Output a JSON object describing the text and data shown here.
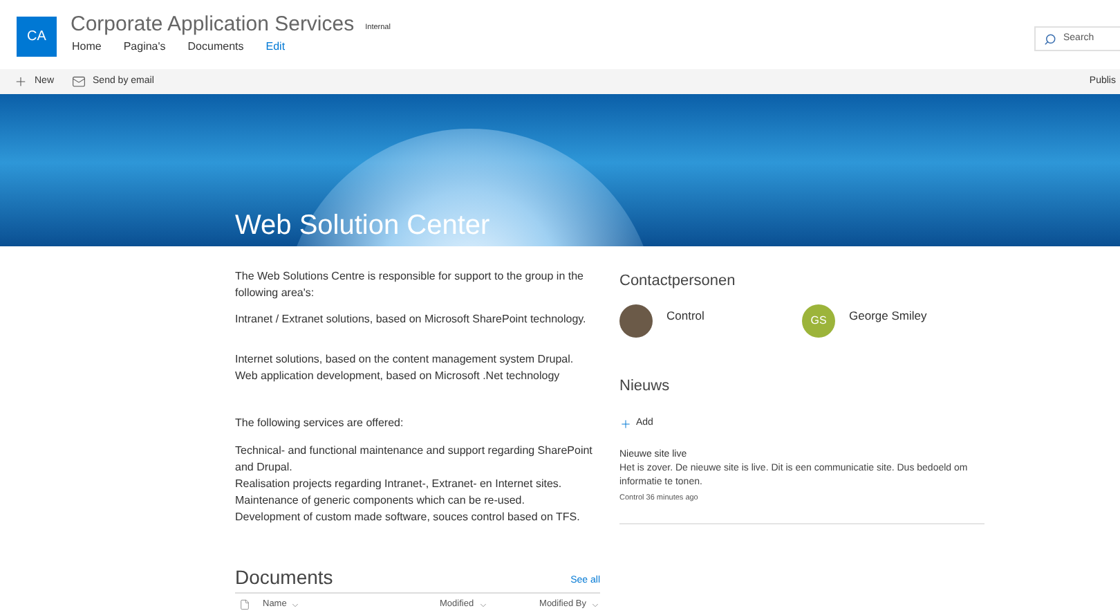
{
  "site": {
    "logo": "CA",
    "title": "Corporate Application Services",
    "badge": "Internal"
  },
  "nav": [
    {
      "label": "Home",
      "kind": "link"
    },
    {
      "label": "Pagina's",
      "kind": "link"
    },
    {
      "label": "Documents",
      "kind": "link"
    },
    {
      "label": "Edit",
      "kind": "edit"
    }
  ],
  "search": {
    "placeholder": "Search"
  },
  "commands": [
    {
      "label": "New",
      "kind": "new"
    },
    {
      "label": "Send by email",
      "kind": "mail"
    }
  ],
  "publish": "Publis",
  "hero": {
    "title": "Web Solution Center"
  },
  "body": [
    {
      "lines": [
        "The Web Solutions Centre is responsible for support to the group in the following area's:"
      ]
    },
    {
      "lines": [
        "Intranet / Extranet solutions, based on Microsoft SharePoint technology."
      ]
    },
    {
      "lines": [
        "Internet solutions, based on the content management system Drupal.",
        "Web application development, based on Microsoft .Net technology"
      ]
    },
    {
      "lines": [
        "The following services are offered:"
      ]
    },
    {
      "lines": [
        "Technical- and functional maintenance and support regarding SharePoint and Drupal.",
        "Realisation projects regarding Intranet-, Extranet- en Internet sites.",
        "Maintenance of generic components which can be re-used.",
        "Development of custom made software, souces control based on TFS."
      ]
    }
  ],
  "documents": {
    "title": "Documents",
    "see_all": "See all",
    "columns": [
      "Name",
      "Modified",
      "Modified By"
    ]
  },
  "contacts": {
    "title": "Contactpersonen",
    "people": [
      {
        "name": "Control",
        "kind": "photo"
      },
      {
        "name": "George Smiley",
        "kind": "initials",
        "initials": "GS",
        "color": "#9cb43a"
      }
    ]
  },
  "news": {
    "title": "Nieuws",
    "add": "Add",
    "items": [
      {
        "title": "Nieuwe site live",
        "text": "Het is zover. De nieuwe site is live. Dit is een communicatie site. Dus bedoeld om informatie te tonen.",
        "meta": "Control 36 minutes ago"
      }
    ]
  }
}
